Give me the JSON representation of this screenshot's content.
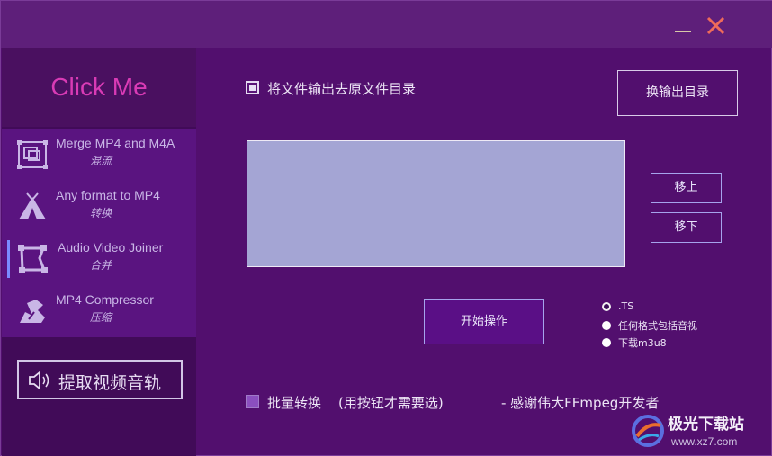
{
  "window": {
    "minimize_symbol": "—",
    "close_symbol": "✕",
    "colors": {
      "background": "#520f6e",
      "sidebar": "#410b58",
      "nav": "#5a1480",
      "brand": "#d93bb5",
      "filelist": "#a4a5d4",
      "start_button": "#5a0f86",
      "close_x": "#ef6b5a"
    }
  },
  "sidebar": {
    "brand": "Click Me",
    "items": [
      {
        "title": "Merge MP4 and M4A",
        "subtitle": "混流",
        "icon": "frame-merge-icon",
        "active": false
      },
      {
        "title": "Any format to MP4",
        "subtitle": "转换",
        "icon": "tent-convert-icon",
        "active": false
      },
      {
        "title": "Audio Video Joiner",
        "subtitle": "合并",
        "icon": "node-shape-icon",
        "active": true
      },
      {
        "title": "MP4 Compressor",
        "subtitle": "压缩",
        "icon": "compress-icon",
        "active": false
      }
    ],
    "extract_button": {
      "label": "提取视频音轨",
      "icon": "speaker-icon"
    }
  },
  "main": {
    "output_to_source_dir": {
      "label": "将文件输出去原文件目录",
      "checked": true
    },
    "change_output_dir_button": "换输出目录",
    "move_up_button": "移上",
    "move_down_button": "移下",
    "start_button": "开始操作",
    "format_options": [
      {
        "label": ".TS",
        "selected": true
      },
      {
        "label": "任何格式包括音视",
        "selected": false
      },
      {
        "label": "下载m3u8",
        "selected": false
      }
    ],
    "batch_convert": {
      "label": "批量转换",
      "checked": false
    },
    "batch_note": "(用按钮才需要选)",
    "credit": "- 感谢伟大FFmpeg开发者"
  },
  "watermark": {
    "title": "极光下载站",
    "url": "www.xz7.com"
  }
}
